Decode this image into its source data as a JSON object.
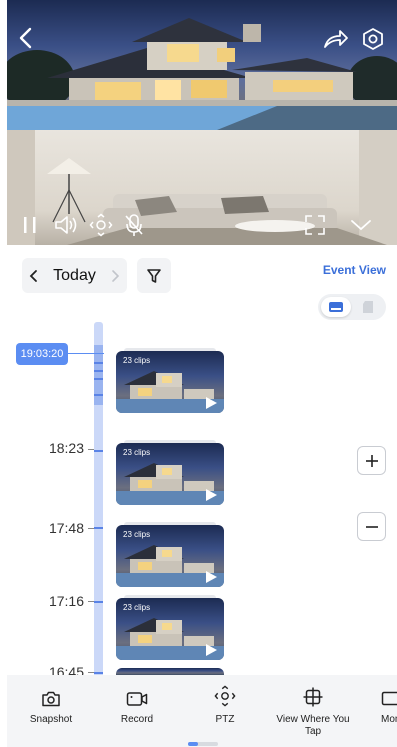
{
  "colors": {
    "accent": "#5b8df2",
    "link": "#3b6fd9",
    "track": "#cbd8f8",
    "toolbar": "#f4f5f7"
  },
  "header": {
    "back_icon": "back-arrow-icon",
    "share_icon": "share-icon",
    "settings_icon": "settings-hexagon-icon"
  },
  "live_controls": {
    "pause_icon": "pause-icon",
    "speaker_icon": "speaker-icon",
    "ptz_icon": "ptz-icon",
    "mic_icon": "mic-muted-icon",
    "fullscreen_icon": "fullscreen-icon",
    "collapse_icon": "chevron-down-icon"
  },
  "date_nav": {
    "prev_icon": "chevron-left-icon",
    "label": "Today",
    "next_icon": "chevron-right-icon",
    "filter_icon": "filter-icon"
  },
  "event_view_label": "Event View",
  "storage_toggle": {
    "selected": "cloud",
    "options": [
      "cloud-storage-icon",
      "sd-card-icon"
    ]
  },
  "timeline": {
    "current_time": "19:03:20",
    "labels": [
      "18:23",
      "17:48",
      "17:16",
      "16:45"
    ]
  },
  "clips": [
    {
      "count": "23 clips"
    },
    {
      "count": "23 clips"
    },
    {
      "count": "23 clips"
    },
    {
      "count": "23 clips"
    }
  ],
  "zoom": {
    "in_icon": "plus-icon",
    "out_icon": "minus-icon"
  },
  "toolbar": {
    "items": [
      {
        "label": "Snapshot",
        "icon": "camera-icon"
      },
      {
        "label": "Record",
        "icon": "video-record-icon"
      },
      {
        "label": "PTZ",
        "icon": "ptz-icon"
      },
      {
        "label": "View Where You Tap",
        "icon": "crosshair-icon"
      },
      {
        "label": "Mon",
        "icon": "monitor-icon"
      }
    ]
  }
}
